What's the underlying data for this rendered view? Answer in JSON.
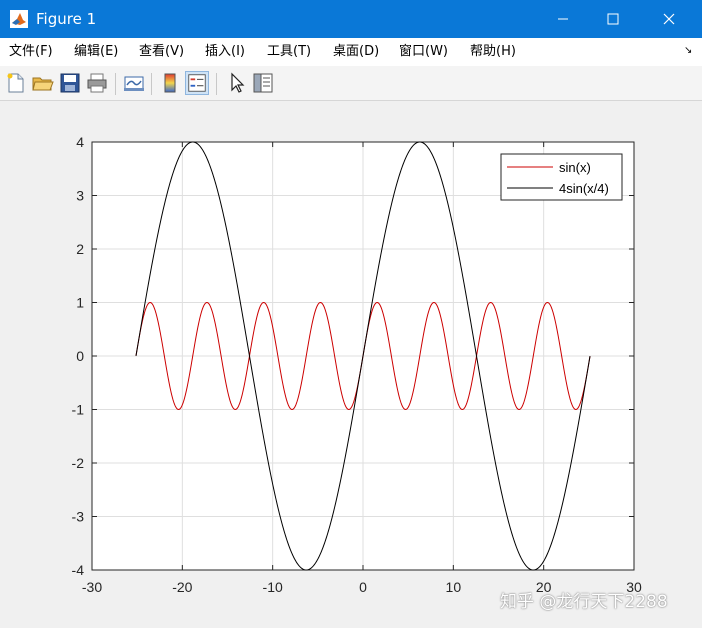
{
  "window": {
    "title": "Figure 1",
    "icon": "matlab-icon",
    "controls": {
      "minimize": "minimize-icon",
      "maximize": "maximize-icon",
      "close": "close-icon"
    }
  },
  "menu": {
    "items": [
      "文件(F)",
      "编辑(E)",
      "查看(V)",
      "插入(I)",
      "工具(T)",
      "桌面(D)",
      "窗口(W)",
      "帮助(H)"
    ],
    "overflow_icon": "dock-arrow-icon"
  },
  "toolbar": {
    "buttons": [
      "new-figure-icon",
      "open-file-icon",
      "save-icon",
      "print-icon",
      "link-plot-icon",
      "colorbar-icon",
      "legend-icon",
      "pointer-icon",
      "property-editor-icon"
    ],
    "active": "legend-icon"
  },
  "watermark": "知乎 @龙行天下2288",
  "chart_data": {
    "type": "line",
    "title": "",
    "xlabel": "",
    "ylabel": "",
    "xlim": [
      -30,
      30
    ],
    "ylim": [
      -4,
      4
    ],
    "xticks": [
      -30,
      -20,
      -10,
      0,
      10,
      20,
      30
    ],
    "yticks": [
      -4,
      -3,
      -2,
      -1,
      0,
      1,
      2,
      3,
      4
    ],
    "grid": true,
    "legend_position": "top-right",
    "x_range": [
      -25.13,
      25.13
    ],
    "series": [
      {
        "name": "sin(x)",
        "color": "#cc0000",
        "expression": "sin(x)",
        "amplitude": 1,
        "period": 6.2832
      },
      {
        "name": "4sin(x/4)",
        "color": "#000000",
        "expression": "4*sin(x/4)",
        "amplitude": 4,
        "period": 25.1327
      }
    ]
  }
}
